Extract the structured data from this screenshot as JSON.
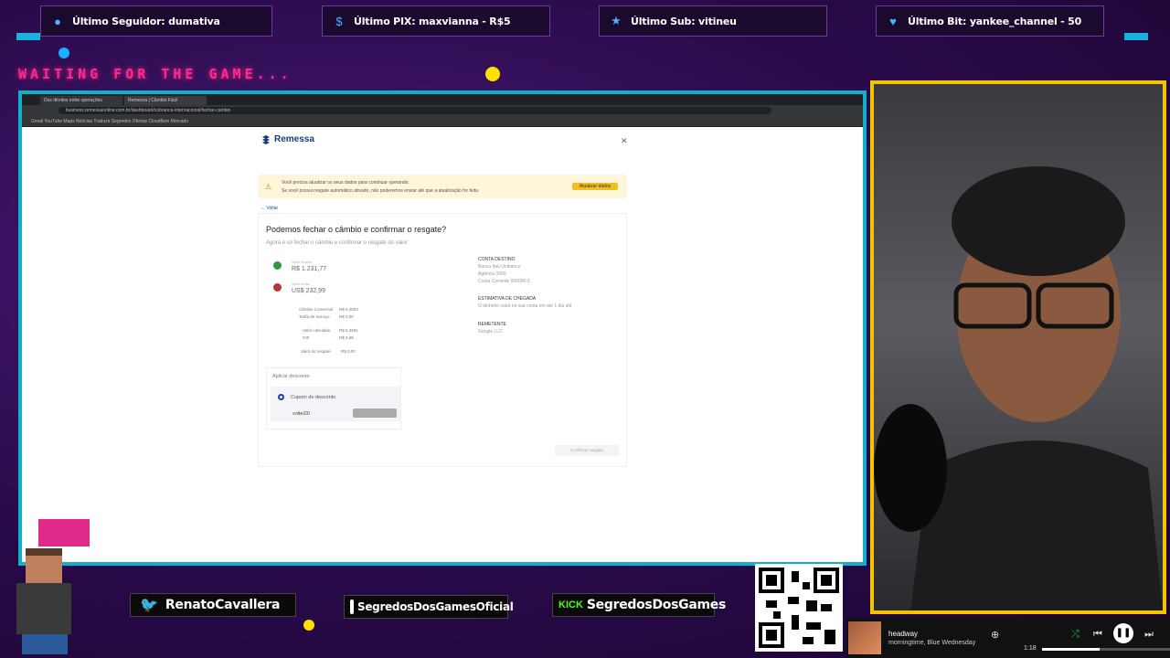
{
  "alerts": [
    {
      "label": "Último Seguidor: dumativa",
      "icon": "user-icon"
    },
    {
      "label": "Último PIX: maxvianna - R$5",
      "icon": "dollar-icon"
    },
    {
      "label": "Último Sub: vitineu",
      "icon": "star-icon"
    },
    {
      "label": "Último Bit: yankee_channel - 50",
      "icon": "heart-icon"
    }
  ],
  "waiting_text": "WAITING FOR THE GAME...",
  "browser": {
    "tab1": "Dos direitos entre operações",
    "tab2": "Remessa | Câmbio Fácil",
    "url": "business.remessaonline.com.br/dashboard/cobranca-internacional/fechar-cambio",
    "bookmarks": "Gmail  YouTube  Maps  Notícias  Traduzir  Segredos  Ofertas  Cloudflare  Mercado"
  },
  "remessa": {
    "brand": "Remessa",
    "banner_line1": "Você precisa atualizar os seus dados para continuar operando.",
    "banner_line2": "Se você possui resgate automático ativado, não poderemos enviar até que a atualização for feita.",
    "banner_button": "Atualizar dados",
    "back": "Voltar",
    "title": "Podemos fechar o câmbio e confirmar o resgate?",
    "subtitle": "Agora é só fechar o câmbio e confirmar o resgate do valor",
    "from_label": "Você recebe",
    "from_value": "R$ 1.231,77",
    "to_label": "Você envia",
    "to_value": "US$ 232,99",
    "rate_label": "Câmbio Comercial",
    "rate_value": "R$ 5,4853",
    "fee_label": "Tarifa de Serviço",
    "fee_value": "R$ 0,00",
    "vet_label": "Valor calculado",
    "vet_value": "R$ 5,3691",
    "iof_label": "IOF",
    "iof_value": "R$ 4,68",
    "total_label": "Valor do resgate",
    "total_value": "R$ 0,00",
    "right": {
      "account_h": "CONTA DESTINO",
      "account_1": "Banco Itaú Unibanco",
      "account_2": "Agência 0000",
      "account_3": "Conta Corrente 000000-0",
      "eta_h": "ESTIMATIVA DE CHEGADA",
      "eta_1": "O dinheiro cairá na sua conta em até 1 dia útil",
      "sender_h": "REMETENTE",
      "sender_1": "Google LLC"
    },
    "discount_label": "Aplicar desconto",
    "coupon_label": "Cupom de desconto",
    "coupon_value": "voltei20",
    "confirm_button": "Confirmar resgate"
  },
  "socials": [
    {
      "label": "RenatoCavallera",
      "icon": "twitter-icon"
    },
    {
      "label": "SegredosDosGamesOficial",
      "icon": "instagram-icon"
    },
    {
      "label": "SegredosDosGames",
      "icon": "kick-icon",
      "prefix": "KICK"
    }
  ],
  "qr_url": "livepix.gg/segredosdosgames",
  "music": {
    "title": "headway",
    "artist": "morningtime, Blue Wednesday",
    "time": "1:18",
    "progress": 0.45
  },
  "colors": {
    "accent": "#0fb0c8",
    "cam_border": "#f5c400",
    "waiting": "#ff2a8a"
  }
}
